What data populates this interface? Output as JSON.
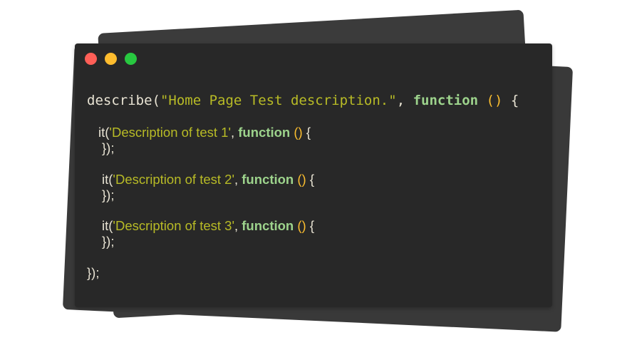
{
  "window_controls": {
    "close_color": "#ff5f57",
    "minimize_color": "#febc2e",
    "maximize_color": "#28c840"
  },
  "code": {
    "describe": {
      "prefix": "describe(",
      "string": "\"Home Page Test description.\"",
      "comma": ", ",
      "keyword": "function",
      "parens": " ()",
      "brace": " {"
    },
    "tests": [
      {
        "prefix": "it(",
        "string": "'Description of test 1'",
        "comma": ", ",
        "keyword": "function",
        "parens": " ()",
        "brace": " {",
        "close": "});"
      },
      {
        "prefix": "it(",
        "string": "'Description of test 2'",
        "comma": ", ",
        "keyword": "function",
        "parens": " ()",
        "brace": " {",
        "close": "});"
      },
      {
        "prefix": "it(",
        "string": "'Description of test 3'",
        "comma": ", ",
        "keyword": "function",
        "parens": " ()",
        "brace": " {",
        "close": "});"
      }
    ],
    "outer_close": "});"
  },
  "colors": {
    "string": "#b8bb26",
    "keyword": "#9dd38c",
    "paren": "#fabd2f",
    "text": "#e8e3d3",
    "window_bg": "#282828"
  }
}
